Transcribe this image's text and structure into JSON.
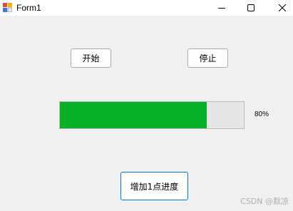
{
  "window": {
    "title": "Form1"
  },
  "buttons": {
    "start_label": "开始",
    "stop_label": "停止",
    "add_label": "增加1点进度"
  },
  "progress": {
    "value": 80,
    "label": "80%",
    "fill_color": "#06b025"
  },
  "watermark": "CSDN @默凉",
  "icons": {
    "app": "form-app-icon",
    "minimize": "minimize-icon",
    "maximize": "maximize-icon",
    "close": "close-icon"
  }
}
